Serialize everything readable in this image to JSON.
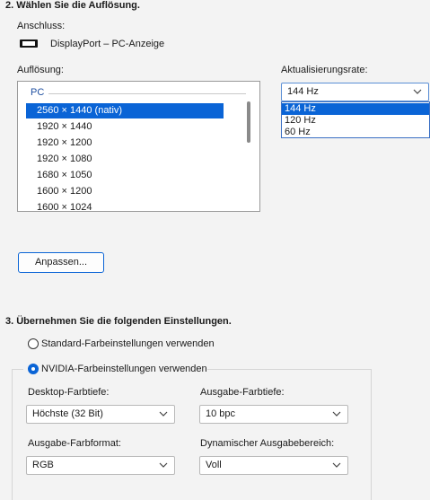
{
  "section2": {
    "heading": "2. Wählen Sie die Auflösung.",
    "connection_label": "Anschluss:",
    "connection_value": "DisplayPort – PC-Anzeige",
    "resolution_label": "Auflösung:",
    "refresh_label": "Aktualisierungsrate:",
    "resolution_group": "PC",
    "resolutions": [
      "2560 × 1440 (nativ)",
      "1920 × 1440",
      "1920 × 1200",
      "1920 × 1080",
      "1680 × 1050",
      "1600 × 1200",
      "1600 × 1024"
    ],
    "selected_resolution": "2560 × 1440 (nativ)",
    "refresh_selected": "144 Hz",
    "refresh_options": [
      "144 Hz",
      "120 Hz",
      "60 Hz"
    ],
    "customize_button": "Anpassen..."
  },
  "section3": {
    "heading": "3. Übernehmen Sie die folgenden Einstellungen.",
    "radio_default": "Standard-Farbeinstellungen verwenden",
    "radio_nvidia": "NVIDIA-Farbeinstellungen verwenden",
    "selected_radio": "NVIDIA-Farbeinstellungen verwenden",
    "desktop_depth_label": "Desktop-Farbtiefe:",
    "desktop_depth_value": "Höchste (32 Bit)",
    "output_depth_label": "Ausgabe-Farbtiefe:",
    "output_depth_value": "10 bpc",
    "output_format_label": "Ausgabe-Farbformat:",
    "output_format_value": "RGB",
    "dynamic_range_label": "Dynamischer Ausgabebereich:",
    "dynamic_range_value": "Voll"
  },
  "colors": {
    "accent": "#0a64d6",
    "background": "#f3f3f3"
  },
  "icons": {
    "monitor": "monitor-icon",
    "dropdown": "chevron-down-icon"
  }
}
